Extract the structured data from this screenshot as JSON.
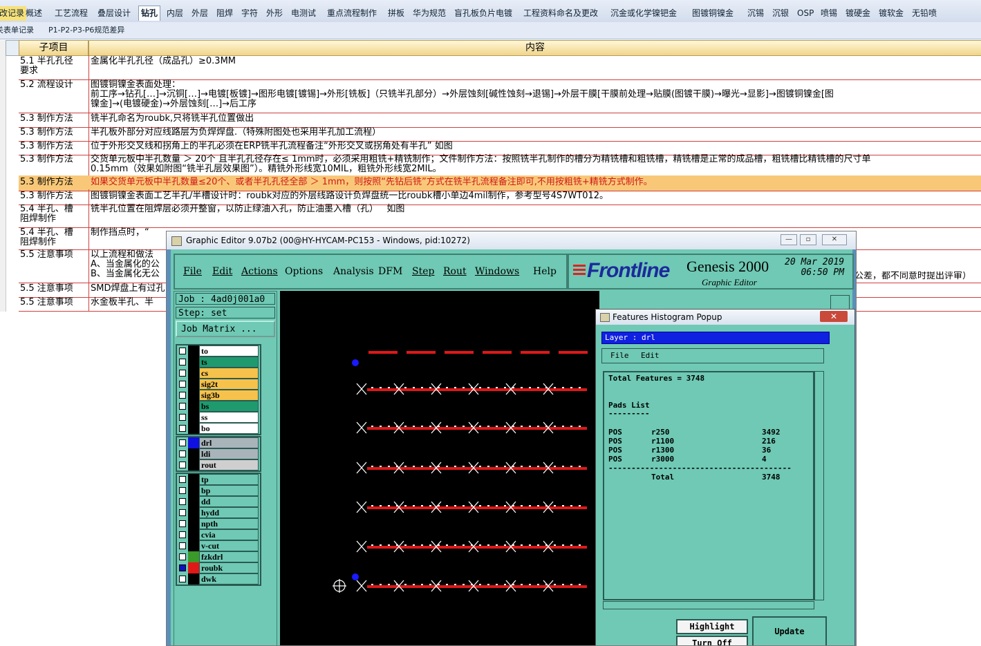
{
  "sheet_tabs": [
    "改记录",
    "概述",
    "工艺流程",
    "叠层设计",
    "钻孔",
    "内层",
    "外层",
    "阻焊",
    "字符",
    "外形",
    "电测试",
    "重点流程制作",
    "拼板",
    "华为规范",
    "盲孔板负片电镀",
    "工程资料命名及更改",
    "沉金或化学镍钯金",
    "图镀铜镍金",
    "沉锡",
    "沉银",
    "OSP",
    "喷锡",
    "镀硬金",
    "镀软金",
    "无铅喷"
  ],
  "sub_tabs": [
    "关表单记录",
    "P1-P2-P3-P6规范差异"
  ],
  "grid": {
    "header_sub": "子项目",
    "header_content": "内容",
    "rows": [
      {
        "sub": "5.1 半孔孔径\n要求",
        "content": "金属化半孔孔径（成品孔）≥0.3MM"
      },
      {
        "sub": "5.2 流程设计",
        "content": "图镀铜镍金表面处理：\n前工序→钻孔[…]→沉铜[…]→电镀[板镀]→图形电镀[镀锡]→外形[铣板]（只铣半孔部分）→外层蚀刻[碱性蚀刻→退锡]→外层干膜[干膜前处理→贴膜(图镀干膜)→曝光→显影]→图镀铜镍金[图\n镍金]→(电镀硬金)→外层蚀刻[…]→后工序"
      },
      {
        "sub": "5.3 制作方法",
        "content": "铣半孔命名为roubk,只将铣半孔位置做出"
      },
      {
        "sub": "5.3 制作方法",
        "content": "半孔板外部分对应线路层为负焊焊盘.（特殊附图处也采用半孔加工流程）"
      },
      {
        "sub": "5.3 制作方法",
        "content": "位于外形交叉线和拐角上的半孔必须在ERP铣半孔流程备注“外形交叉或拐角处有半孔” 如图"
      },
      {
        "sub": "5.3 制作方法",
        "content": "交货单元板中半孔数量 ＞ 20个 且半孔孔径存在≤ 1mm时，必须采用粗铣+精铣制作；文件制作方法：按照铣半孔制作的槽分为精铣槽和粗铣槽，精铣槽是正常的成品槽，粗铣槽比精铣槽的尺寸单\n0.15mm（效果如附图“铣半孔层效果图”）。精铣外形线宽10MIL，粗铣外形线宽2MIL。"
      },
      {
        "sub": "5.3 制作方法",
        "content": "如果交货单元板中半孔数量≤20个、或者半孔孔径全部 ＞ 1mm，则按照“先钻后铣”方式在铣半孔流程备注即可,不用按粗铣+精铣方式制作。"
      },
      {
        "sub": "5.3 制作方法",
        "content": "图镀铜镍金表面工艺半孔/半槽设计时：roubk对应的外层线路设计负焊盘统一比roubk槽小单边4mil制作，参考型号4S7WT012。"
      },
      {
        "sub": "5.4 半孔、槽\n阻焊制作",
        "content": "铣半孔位置在阻焊层必须开整窗，以防止绿油入孔，防止油墨入槽（孔）   如图"
      },
      {
        "sub": "5.4 半孔、槽\n阻焊制作",
        "content": "制作挡点时，“"
      },
      {
        "sub": "5.5 注意事项",
        "content": "以上流程和做法\nA、当金属化的公\nB、当金属化无公",
        "content_right": "公差，都不同意时提出评审）"
      },
      {
        "sub": "5.5 注意事项",
        "content": "SMD焊盘上有过孔"
      },
      {
        "sub": "5.5 注意事项",
        "content": "水金板半孔、半"
      }
    ]
  },
  "genesis": {
    "window_title": "Graphic Editor 9.07b2 (00@HY-HYCAM-PC153 - Windows, pid:10272)",
    "menus": [
      "File",
      "Edit",
      "Actions",
      "Options",
      "Analysis",
      "DFM",
      "Step",
      "Rout",
      "Windows",
      "Help"
    ],
    "brand_logo": "Frontline",
    "brand_title": "Genesis 2000",
    "brand_subtitle": "Graphic Editor",
    "date": "20 Mar 2019",
    "time": "06:50 PM",
    "job_label": "Job : 4ad0j001a0",
    "step_label": "Step: set",
    "job_matrix_button": "Job Matrix ...",
    "layer_groups": [
      [
        {
          "name": "to",
          "color": "#ffffff"
        },
        {
          "name": "ts",
          "color": "#1f9a6e"
        },
        {
          "name": "cs",
          "color": "#f6c24b"
        },
        {
          "name": "sig2t",
          "color": "#f6c24b"
        },
        {
          "name": "sig3b",
          "color": "#f6c24b"
        },
        {
          "name": "bs",
          "color": "#1f9a6e"
        },
        {
          "name": "ss",
          "color": "#ffffff"
        },
        {
          "name": "bo",
          "color": "#ffffff"
        }
      ],
      [
        {
          "name": "drl",
          "color": "#a9b4ba",
          "swatch": "#1010e0"
        },
        {
          "name": "ldi",
          "color": "#a9b4ba"
        },
        {
          "name": "rout",
          "color": "#cfcfcf"
        }
      ],
      [
        {
          "name": "tp",
          "color": "#6fc9b4"
        },
        {
          "name": "bp",
          "color": "#6fc9b4"
        },
        {
          "name": "dd",
          "color": "#6fc9b4"
        },
        {
          "name": "hydd",
          "color": "#6fc9b4"
        },
        {
          "name": "npth",
          "color": "#6fc9b4"
        },
        {
          "name": "cvia",
          "color": "#6fc9b4"
        },
        {
          "name": "v-cut",
          "color": "#6fc9b4"
        },
        {
          "name": "fzkdrl",
          "color": "#6fc9b4",
          "swatch": "#3a9a2a"
        },
        {
          "name": "roubk",
          "color": "#6fc9b4",
          "swatch": "#e01818",
          "checked": true
        },
        {
          "name": "dwk",
          "color": "#6fc9b4"
        }
      ]
    ]
  },
  "histogram": {
    "title": "Features Histogram Popup",
    "layer_label": "Layer :  drl",
    "menu": [
      "File",
      "Edit"
    ],
    "total_features": "Total Features = 3748",
    "list_title": "Pads List",
    "separator_short": "---------",
    "rows": [
      {
        "pol": "POS",
        "sym": "r250",
        "count": "3492"
      },
      {
        "pol": "POS",
        "sym": "r1100",
        "count": "216"
      },
      {
        "pol": "POS",
        "sym": "r1300",
        "count": "36"
      },
      {
        "pol": "POS",
        "sym": "r3000",
        "count": "4"
      }
    ],
    "separator_long": "----------------------------------------",
    "total_label": "Total",
    "total_value": "3748",
    "buttons": {
      "highlight": "Highlight",
      "turn_off": "Turn Off",
      "update": "Update"
    }
  }
}
